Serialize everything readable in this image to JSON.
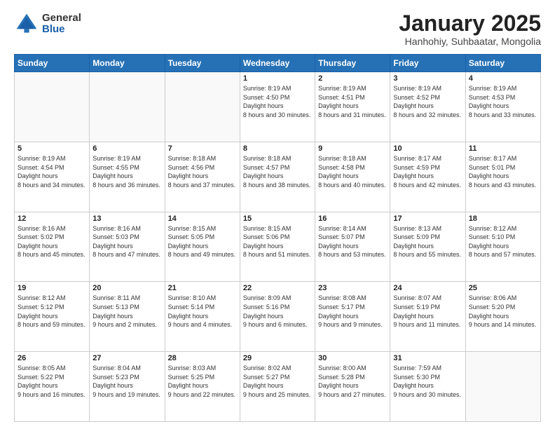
{
  "logo": {
    "general": "General",
    "blue": "Blue"
  },
  "header": {
    "month": "January 2025",
    "location": "Hanhohiy, Suhbaatar, Mongolia"
  },
  "weekdays": [
    "Sunday",
    "Monday",
    "Tuesday",
    "Wednesday",
    "Thursday",
    "Friday",
    "Saturday"
  ],
  "weeks": [
    [
      {
        "day": "",
        "empty": true
      },
      {
        "day": "",
        "empty": true
      },
      {
        "day": "",
        "empty": true
      },
      {
        "day": "1",
        "sunrise": "8:19 AM",
        "sunset": "4:50 PM",
        "daylight": "8 hours and 30 minutes."
      },
      {
        "day": "2",
        "sunrise": "8:19 AM",
        "sunset": "4:51 PM",
        "daylight": "8 hours and 31 minutes."
      },
      {
        "day": "3",
        "sunrise": "8:19 AM",
        "sunset": "4:52 PM",
        "daylight": "8 hours and 32 minutes."
      },
      {
        "day": "4",
        "sunrise": "8:19 AM",
        "sunset": "4:53 PM",
        "daylight": "8 hours and 33 minutes."
      }
    ],
    [
      {
        "day": "5",
        "sunrise": "8:19 AM",
        "sunset": "4:54 PM",
        "daylight": "8 hours and 34 minutes."
      },
      {
        "day": "6",
        "sunrise": "8:19 AM",
        "sunset": "4:55 PM",
        "daylight": "8 hours and 36 minutes."
      },
      {
        "day": "7",
        "sunrise": "8:18 AM",
        "sunset": "4:56 PM",
        "daylight": "8 hours and 37 minutes."
      },
      {
        "day": "8",
        "sunrise": "8:18 AM",
        "sunset": "4:57 PM",
        "daylight": "8 hours and 38 minutes."
      },
      {
        "day": "9",
        "sunrise": "8:18 AM",
        "sunset": "4:58 PM",
        "daylight": "8 hours and 40 minutes."
      },
      {
        "day": "10",
        "sunrise": "8:17 AM",
        "sunset": "4:59 PM",
        "daylight": "8 hours and 42 minutes."
      },
      {
        "day": "11",
        "sunrise": "8:17 AM",
        "sunset": "5:01 PM",
        "daylight": "8 hours and 43 minutes."
      }
    ],
    [
      {
        "day": "12",
        "sunrise": "8:16 AM",
        "sunset": "5:02 PM",
        "daylight": "8 hours and 45 minutes."
      },
      {
        "day": "13",
        "sunrise": "8:16 AM",
        "sunset": "5:03 PM",
        "daylight": "8 hours and 47 minutes."
      },
      {
        "day": "14",
        "sunrise": "8:15 AM",
        "sunset": "5:05 PM",
        "daylight": "8 hours and 49 minutes."
      },
      {
        "day": "15",
        "sunrise": "8:15 AM",
        "sunset": "5:06 PM",
        "daylight": "8 hours and 51 minutes."
      },
      {
        "day": "16",
        "sunrise": "8:14 AM",
        "sunset": "5:07 PM",
        "daylight": "8 hours and 53 minutes."
      },
      {
        "day": "17",
        "sunrise": "8:13 AM",
        "sunset": "5:09 PM",
        "daylight": "8 hours and 55 minutes."
      },
      {
        "day": "18",
        "sunrise": "8:12 AM",
        "sunset": "5:10 PM",
        "daylight": "8 hours and 57 minutes."
      }
    ],
    [
      {
        "day": "19",
        "sunrise": "8:12 AM",
        "sunset": "5:12 PM",
        "daylight": "8 hours and 59 minutes."
      },
      {
        "day": "20",
        "sunrise": "8:11 AM",
        "sunset": "5:13 PM",
        "daylight": "9 hours and 2 minutes."
      },
      {
        "day": "21",
        "sunrise": "8:10 AM",
        "sunset": "5:14 PM",
        "daylight": "9 hours and 4 minutes."
      },
      {
        "day": "22",
        "sunrise": "8:09 AM",
        "sunset": "5:16 PM",
        "daylight": "9 hours and 6 minutes."
      },
      {
        "day": "23",
        "sunrise": "8:08 AM",
        "sunset": "5:17 PM",
        "daylight": "9 hours and 9 minutes."
      },
      {
        "day": "24",
        "sunrise": "8:07 AM",
        "sunset": "5:19 PM",
        "daylight": "9 hours and 11 minutes."
      },
      {
        "day": "25",
        "sunrise": "8:06 AM",
        "sunset": "5:20 PM",
        "daylight": "9 hours and 14 minutes."
      }
    ],
    [
      {
        "day": "26",
        "sunrise": "8:05 AM",
        "sunset": "5:22 PM",
        "daylight": "9 hours and 16 minutes."
      },
      {
        "day": "27",
        "sunrise": "8:04 AM",
        "sunset": "5:23 PM",
        "daylight": "9 hours and 19 minutes."
      },
      {
        "day": "28",
        "sunrise": "8:03 AM",
        "sunset": "5:25 PM",
        "daylight": "9 hours and 22 minutes."
      },
      {
        "day": "29",
        "sunrise": "8:02 AM",
        "sunset": "5:27 PM",
        "daylight": "9 hours and 25 minutes."
      },
      {
        "day": "30",
        "sunrise": "8:00 AM",
        "sunset": "5:28 PM",
        "daylight": "9 hours and 27 minutes."
      },
      {
        "day": "31",
        "sunrise": "7:59 AM",
        "sunset": "5:30 PM",
        "daylight": "9 hours and 30 minutes."
      },
      {
        "day": "",
        "empty": true
      }
    ]
  ]
}
